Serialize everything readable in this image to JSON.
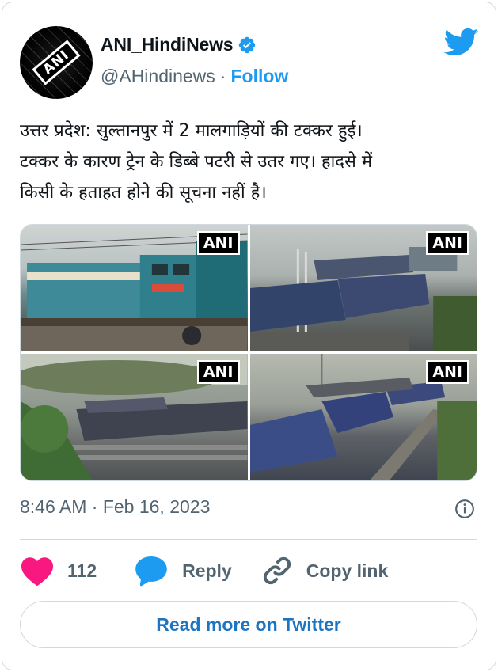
{
  "author": {
    "name": "ANI_HindiNews",
    "handle": "@AHindinews",
    "separator": "·",
    "follow_label": "Follow",
    "avatar_text": "ANI"
  },
  "tweet": {
    "text_line1": "उत्तर प्रदेश: सुल्तानपुर में 2 मालगाड़ियों की टक्कर हुई।",
    "text_line2": "टक्कर के कारण ट्रेन के डिब्बे पटरी से उतर गए। हादसे में",
    "text_line3": "किसी के हताहत होने की सूचना नहीं है।",
    "photos": [
      {
        "watermark": "ANI"
      },
      {
        "watermark": "ANI"
      },
      {
        "watermark": "ANI"
      },
      {
        "watermark": "ANI"
      }
    ],
    "timestamp": "8:46 AM · Feb 16, 2023"
  },
  "actions": {
    "likes_count": "112",
    "reply_label": "Reply",
    "copy_link_label": "Copy link"
  },
  "read_more_label": "Read more on Twitter",
  "colors": {
    "brand_blue": "#1d9bf0",
    "like_pink": "#f91880",
    "secondary_text": "#536471",
    "border": "#cfd9de"
  }
}
